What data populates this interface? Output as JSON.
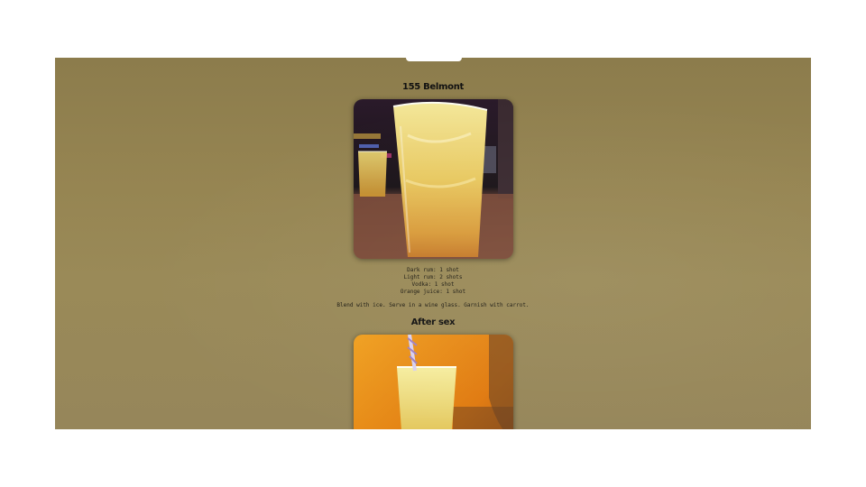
{
  "drinks": [
    {
      "title": "155 Belmont",
      "ingredients": [
        "Dark rum: 1 shot",
        "Light rum: 2 shots",
        "Vodka: 1 shot",
        "Orange juice: 1 shot"
      ],
      "method": "Blend with ice. Serve in a wine glass. Garnish with carrot."
    },
    {
      "title": "After sex"
    }
  ]
}
